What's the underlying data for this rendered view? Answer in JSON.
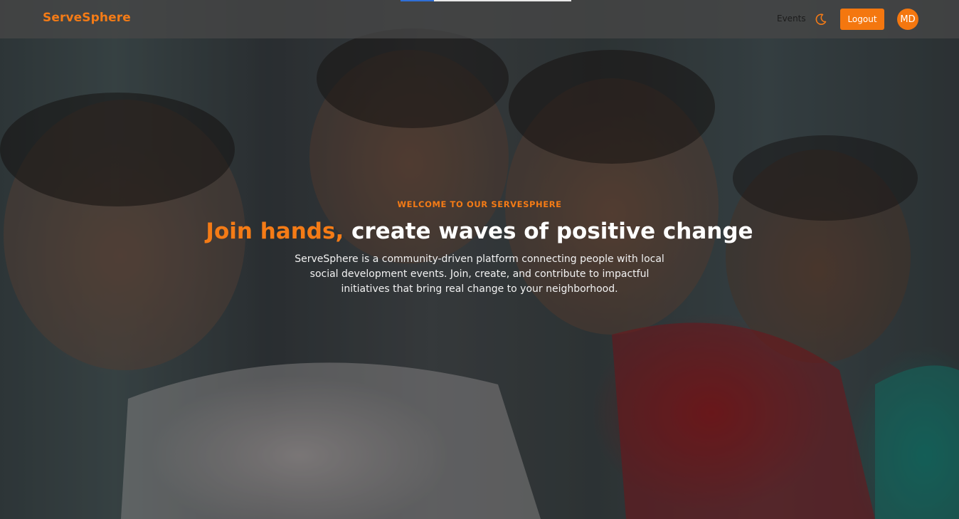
{
  "app": {
    "brand": "ServeSphere"
  },
  "nav": {
    "events_label": "Events",
    "theme_icon": "moon-icon",
    "logout_label": "Logout",
    "avatar_initials": "MD"
  },
  "hero": {
    "eyebrow": "WELCOME TO OUR SERVESPHERE",
    "headline_accent": "Join hands,",
    "headline_rest": "create waves of positive change",
    "description": "ServeSphere is a community-driven platform connecting people with local social development events. Join, create, and contribute to impactful initiatives that bring real change to your neighborhood."
  },
  "colors": {
    "accent": "#f47b16",
    "topbar": "#464646",
    "text_light": "#ffffff"
  }
}
